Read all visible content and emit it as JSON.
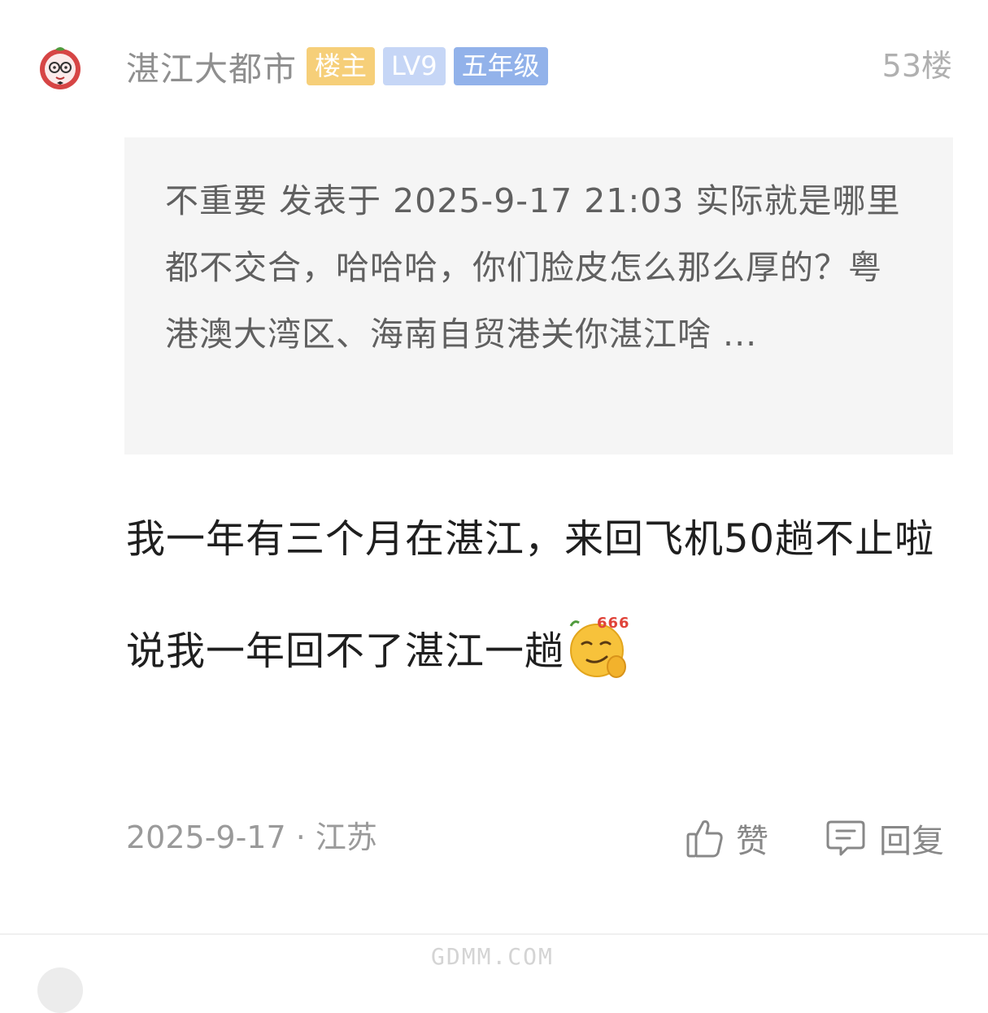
{
  "post": {
    "author": {
      "name": "湛江大都市",
      "badges": {
        "owner": "楼主",
        "level": "LV9",
        "grade": "五年级"
      },
      "avatar_icon": "lychee-mascot-avatar-icon"
    },
    "floor": "53楼",
    "quote": {
      "text": "不重要 发表于 2025-9-17 21:03 实际就是哪里都不交合，哈哈哈，你们脸皮怎么那么厚的？粤港澳大湾区、海南自贸港关你湛江啥 ..."
    },
    "content": {
      "paragraph1": "我一年有三个月在湛江，来回飞机50趟不止啦",
      "paragraph2": "说我一年回不了湛江一趟",
      "emoji_icon": "smirk-666-emoji-icon"
    },
    "footer": {
      "meta": "2025-9-17 · 江苏",
      "like_label": "赞",
      "reply_label": "回复"
    }
  },
  "watermark": "GDMM.COM",
  "colors": {
    "owner_badge": "#f6cf79",
    "level_badge": "#c6d6f6",
    "grade_badge": "#92b2ea",
    "quote_background": "#f5f5f5",
    "username": "#8f8f8f"
  }
}
